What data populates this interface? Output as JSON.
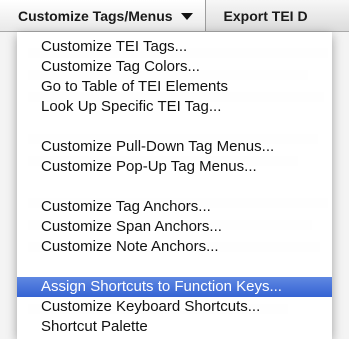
{
  "menubar": {
    "items": [
      {
        "label": "Customize Tags/Menus",
        "active": true
      },
      {
        "label": "Export TEI D",
        "active": false
      }
    ]
  },
  "menu": {
    "groups": [
      {
        "items": [
          "Customize TEI Tags...",
          "Customize Tag Colors...",
          "Go to Table of TEI Elements",
          "Look Up Specific TEI Tag..."
        ]
      },
      {
        "items": [
          "Customize Pull-Down Tag Menus...",
          "Customize Pop-Up Tag Menus..."
        ]
      },
      {
        "items": [
          "Customize Tag Anchors...",
          "Customize Span Anchors...",
          "Customize Note Anchors..."
        ]
      },
      {
        "items": [
          "Assign Shortcuts to Function Keys...",
          "Customize Keyboard Shortcuts...",
          "Shortcut Palette"
        ]
      }
    ],
    "highlighted_item": "Assign Shortcuts to Function Keys..."
  },
  "colors": {
    "highlight": "#3563d3",
    "menubar_text": "#1a1a1a"
  }
}
